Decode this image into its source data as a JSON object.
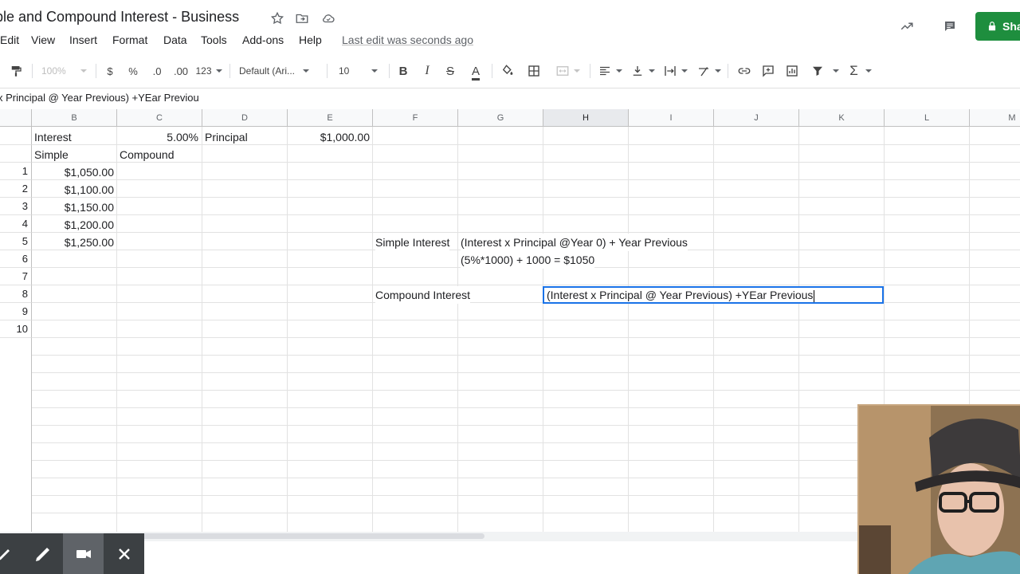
{
  "title_bar": {
    "document_title": "ple and Compound Interest - Business",
    "share_label": "Sha"
  },
  "menu": {
    "items": [
      "Edit",
      "View",
      "Insert",
      "Format",
      "Data",
      "Tools",
      "Add-ons",
      "Help"
    ],
    "last_edit": "Last edit was seconds ago"
  },
  "toolbar": {
    "zoom": "100%",
    "currency": "$",
    "percent": "%",
    "decrease_decimals": ".0",
    "increase_decimals": ".00",
    "more_formats": "123",
    "font_family": "Default (Ari...",
    "font_size": "10",
    "bold": "B",
    "italic": "I",
    "strikethrough": "S",
    "text_color": "A",
    "text_color_value": "#000000",
    "functions": "Σ"
  },
  "formula_bar": {
    "content": "x Principal @ Year Previous) +YEar Previou"
  },
  "grid": {
    "column_headers": [
      "B",
      "C",
      "D",
      "E",
      "F",
      "G",
      "H",
      "I",
      "J",
      "K",
      "L",
      "M"
    ],
    "row_headers": [
      "1",
      "2",
      "3",
      "4",
      "5",
      "6",
      "7",
      "8",
      "9",
      "10"
    ],
    "cells": {
      "B_interest": "Interest",
      "C_rate": "5.00%",
      "D_principal": "Principal",
      "E_principal_value": "$1,000.00",
      "B_simple": "Simple",
      "C_compound": "Compound",
      "B1": "$1,050.00",
      "B2": "$1,100.00",
      "B3": "$1,150.00",
      "B4": "$1,200.00",
      "B5": "$1,250.00",
      "F5": "Simple Interest",
      "G5": "(Interest x Principal @Year 0) + Year Previous",
      "G6": "(5%*1000) + 1000 = $1050",
      "F8": "Compound Interest",
      "H8": "(Interest x Principal @ Year Previous) +YEar Previous"
    },
    "active_cell": "H",
    "accent_color": "#1a73e8"
  },
  "colors": {
    "share_green": "#1e8e3e",
    "annotation_bar": "#3c4043"
  }
}
